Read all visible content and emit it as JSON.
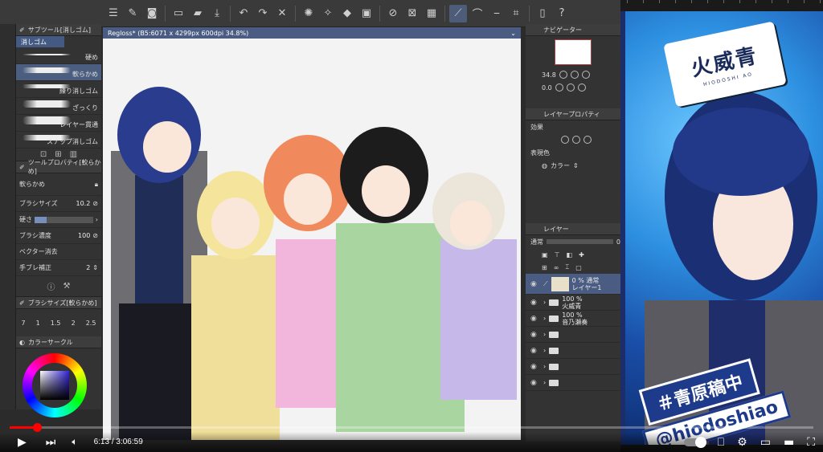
{
  "canvas": {
    "tab_title": "Regloss* (B5:6071 x 4299px 600dpi 34.8%)"
  },
  "left_panel": {
    "subtool_header": "サブツール[消しゴム]",
    "subtool_tab": "消しゴム",
    "brushes": [
      {
        "name": "硬め"
      },
      {
        "name": "軟らかめ"
      },
      {
        "name": "練り消しゴム"
      },
      {
        "name": "ざっくり"
      },
      {
        "name": "レイヤー貫通"
      },
      {
        "name": "スナップ消しゴム"
      }
    ],
    "tool_property_header": "ツールプロパティ[軟らかめ]",
    "tool_property_subtab": "軟らかめ",
    "props": [
      {
        "label": "ブラシサイズ",
        "value": "10.2"
      },
      {
        "label": "硬さ",
        "value": ""
      },
      {
        "label": "ブラシ濃度",
        "value": "100"
      },
      {
        "label": "ベクター消去",
        "value": ""
      },
      {
        "label": "手ブレ補正",
        "value": "2"
      }
    ],
    "brush_size_header": "ブラシサイズ[軟らかめ]",
    "size_ticks": [
      "7",
      "1",
      "1.5",
      "2",
      "2.5"
    ],
    "color_circle_header": "カラーサークル"
  },
  "right_panel": {
    "navigator_header": "ナビゲーター",
    "zoom_value": "34.8",
    "rotation_value": "0.0",
    "layer_property_header": "レイヤープロパティ",
    "effect_label": "効果",
    "display_color_label": "表現色",
    "display_color_value": "カラー",
    "layer_header": "レイヤー",
    "blend_mode": "通常",
    "opacity_value": "0",
    "layers": [
      {
        "line1": "0 % 通常",
        "line2": "レイヤー1",
        "type": "raster"
      },
      {
        "line1": "100 %",
        "line2": "火威青",
        "type": "folder"
      },
      {
        "line1": "100 %",
        "line2": "音乃瀬奏",
        "type": "folder"
      },
      {
        "line1": "",
        "line2": "",
        "type": "folder"
      },
      {
        "line1": "",
        "line2": "",
        "type": "folder"
      },
      {
        "line1": "",
        "line2": "",
        "type": "folder"
      },
      {
        "line1": "",
        "line2": "",
        "type": "folder"
      }
    ]
  },
  "overlay": {
    "logo_text": "火威青",
    "logo_subtext": "HIODOSHI AO",
    "banner_hashtag": "＃青原稿中",
    "banner_handle": "@hiodoshiao"
  },
  "player": {
    "time": "6:13 / 3:06:59",
    "progress": 0.034
  }
}
